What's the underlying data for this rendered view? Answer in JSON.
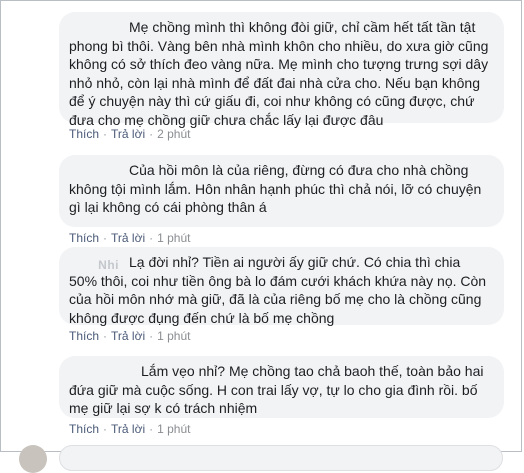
{
  "comments": [
    {
      "author": "",
      "text": "Mẹ chồng mình thì không đòi giữ, chỉ cầm hết tất tần tật phong bì thôi. Vàng bên nhà mình khôn cho nhiều, do xưa giờ cũng không có sở thích đeo vàng nữa. Mẹ mình cho tượng trưng sợi dây nhỏ nhỏ, còn lại nhà mình để đất đai nhà cửa cho. Nếu bạn không để ý chuyện này thì cứ giấu đi, coi như không có cũng được, chứ đưa cho mẹ chồng giữ chưa chắc lấy lại được đâu",
      "like": "Thích",
      "reply": "Trả lời",
      "time": "2 phút"
    },
    {
      "author": "",
      "text": "Của hồi môn là của riêng, đừng có đưa cho nhà chồng không tội mình lắm. Hôn nhân hạnh phúc thì chả nói, lỡ có chuyện gì lại không có cái phòng thân á",
      "like": "Thích",
      "reply": "Trả lời",
      "time": "1 phút"
    },
    {
      "author": "Nhi",
      "text": "Lạ đời nhỉ? Tiền ai người ấy giữ chứ. Có chia thì chia 50% thôi, coi như tiền ông bà lo đám cưới khách khứa này nọ. Còn của hồi môn nhớ mà giữ, đã là của riêng bố mẹ cho là chồng cũng không được đụng đến chứ là bố mẹ chồng",
      "like": "Thích",
      "reply": "Trả lời",
      "time": "1 phút"
    },
    {
      "author": "",
      "text": "Lắm vẹo nhỉ? Mẹ chồng tao chả baoh thế, toàn bảo hai đứa giữ mà cuộc sống. H con trai lấy vợ, tự lo cho gia đình rồi. bố mẹ giữ lại sợ k có trách nhiệm",
      "like": "Thích",
      "reply": "Trả lời",
      "time": "1 phút"
    }
  ]
}
